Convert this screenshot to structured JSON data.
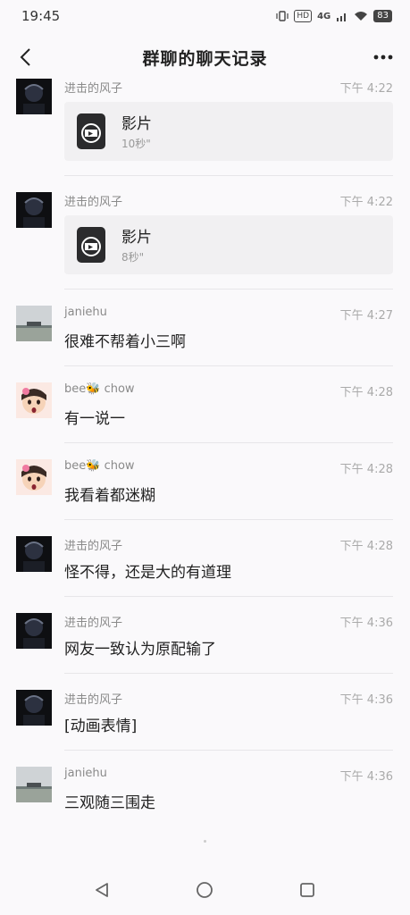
{
  "status": {
    "time": "19:45",
    "network": "4G",
    "hd": "HD",
    "battery": "83"
  },
  "header": {
    "title": "群聊的聊天记录"
  },
  "messages": [
    {
      "avatar": "dark",
      "sender": "进击的风子",
      "time": "下午 4:22",
      "type": "video",
      "video_title": "影片",
      "duration": "10秒\""
    },
    {
      "avatar": "dark",
      "sender": "进击的风子",
      "time": "下午 4:22",
      "type": "video",
      "video_title": "影片",
      "duration": "8秒\""
    },
    {
      "avatar": "beach",
      "sender": "janiehu",
      "time": "下午 4:27",
      "type": "text",
      "text": "很难不帮着小三啊"
    },
    {
      "avatar": "girl",
      "sender": "bee🐝 chow",
      "time": "下午 4:28",
      "type": "text",
      "text": "有一说一"
    },
    {
      "avatar": "girl",
      "sender": "bee🐝 chow",
      "time": "下午 4:28",
      "type": "text",
      "text": "我看着都迷糊"
    },
    {
      "avatar": "dark",
      "sender": "进击的风子",
      "time": "下午 4:28",
      "type": "text",
      "text": "怪不得，还是大的有道理"
    },
    {
      "avatar": "dark",
      "sender": "进击的风子",
      "time": "下午 4:36",
      "type": "text",
      "text": "网友一致认为原配输了"
    },
    {
      "avatar": "dark",
      "sender": "进击的风子",
      "time": "下午 4:36",
      "type": "text",
      "text": "[动画表情]"
    },
    {
      "avatar": "beach",
      "sender": "janiehu",
      "time": "下午 4:36",
      "type": "text",
      "text": "三观随三围走"
    }
  ],
  "icons": {
    "back": "chevron-left-icon",
    "more": "more-dots-icon",
    "video": "video-file-icon",
    "nav_back": "triangle-back-icon",
    "nav_home": "circle-home-icon",
    "nav_recent": "square-recent-icon"
  },
  "colors": {
    "background": "#faf9fb",
    "card": "#f1f0f2",
    "meta_text": "#8a8a8a"
  }
}
